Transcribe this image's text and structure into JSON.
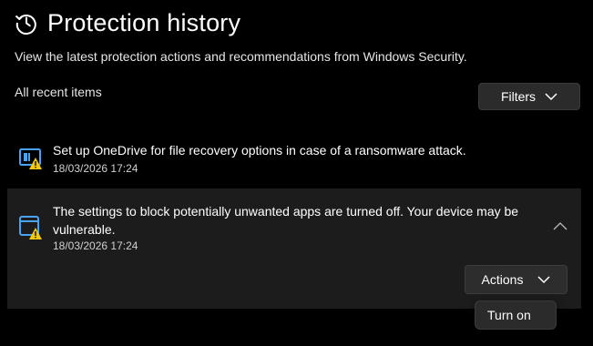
{
  "header": {
    "title": "Protection history",
    "subtitle": "View the latest protection actions and recommendations from Windows Security.",
    "icon": "history-clock-icon"
  },
  "list": {
    "label": "All recent items",
    "filters_label": "Filters"
  },
  "items": [
    {
      "title": "Set up OneDrive for file recovery options in case of a ransomware attack.",
      "timestamp": "18/03/2026 17:24",
      "icon": "ransomware-warning-icon"
    },
    {
      "title_line1": "The settings to block potentially unwanted apps are turned off. Your device may be",
      "title_line2": "vulnerable.",
      "timestamp": "18/03/2026 17:24",
      "icon": "app-browser-warning-icon",
      "expanded": true,
      "actions_label": "Actions",
      "actions_menu": [
        "Turn on"
      ]
    }
  ],
  "colors": {
    "background": "#000000",
    "expanded_item_bg": "#1c1c1c",
    "button_bg": "#2b2b2b",
    "accent_blue": "#4aa3f0",
    "warning_yellow": "#f2c811"
  }
}
